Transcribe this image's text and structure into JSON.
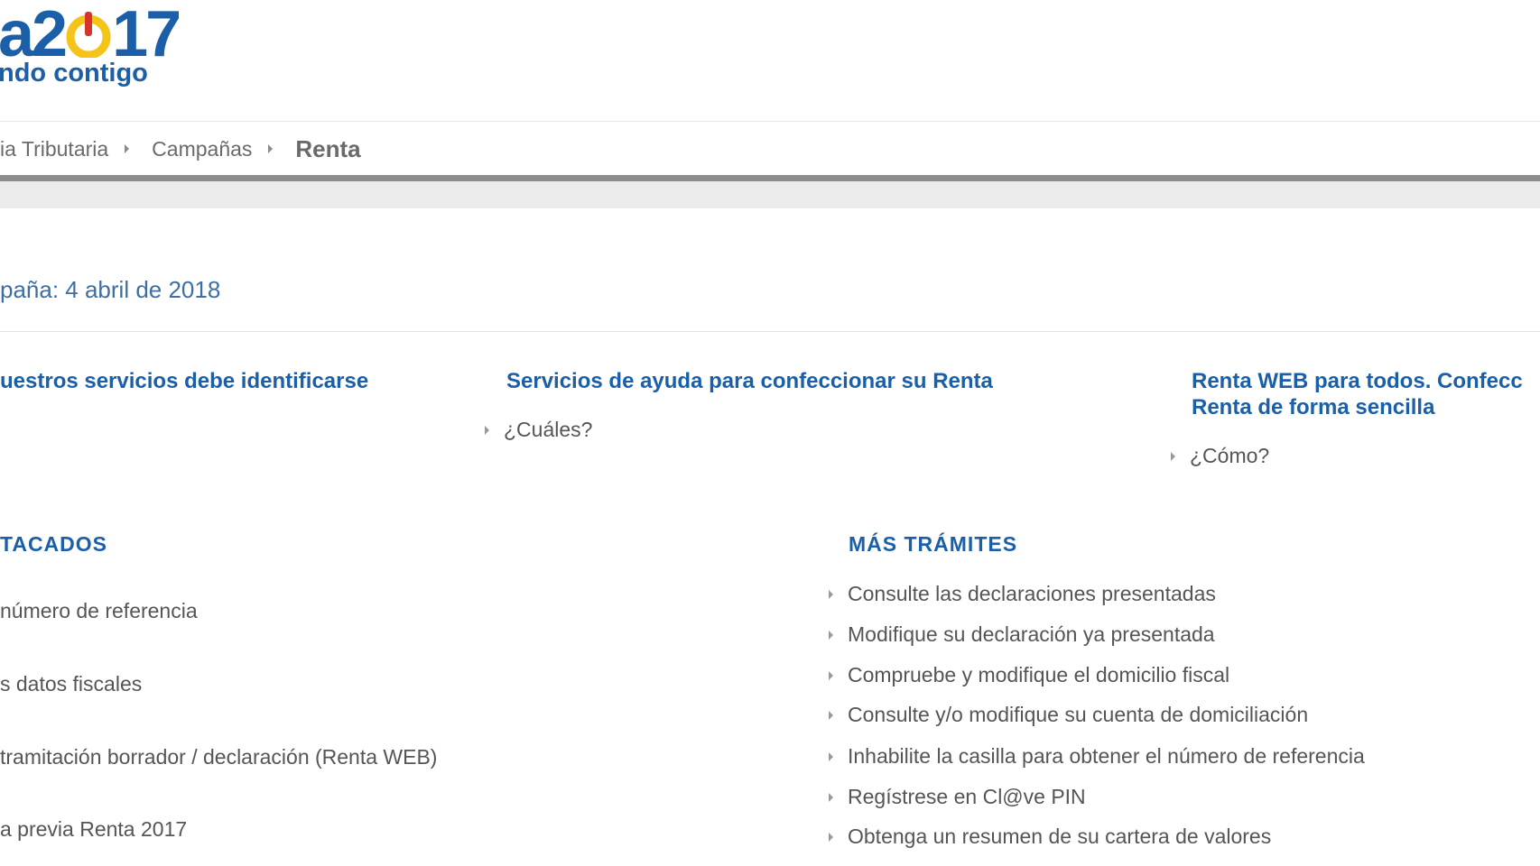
{
  "header": {
    "logo_main_left": "a2",
    "logo_main_right": "17",
    "logo_sub": "ndo contigo"
  },
  "breadcrumb": {
    "items": [
      "ia Tributaria",
      "Campañas"
    ],
    "current": "Renta"
  },
  "campaign": {
    "text": "paña: 4 abril de 2018"
  },
  "services": [
    {
      "title": "uestros servicios debe identificarse"
    },
    {
      "title": "Servicios de ayuda para confeccionar su Renta",
      "link": "¿Cuáles?"
    },
    {
      "title_line1": "Renta WEB para todos. Confecc",
      "title_line2": "Renta de forma sencilla",
      "link": "¿Cómo?"
    }
  ],
  "destacados": {
    "title": "TACADOS",
    "items": [
      "número de referencia",
      "s datos fiscales",
      "tramitación borrador / declaración (Renta WEB)",
      "a previa Renta 2017"
    ]
  },
  "mas_tramites": {
    "title": "MÁS TRÁMITES",
    "items": [
      "Consulte las declaraciones presentadas",
      "Modifique su declaración ya presentada",
      "Compruebe y modifique el domicilio fiscal",
      "Consulte y/o modifique su cuenta de domiciliación",
      "Inhabilite la casilla para obtener el número de referencia",
      "Regístrese en Cl@ve PIN",
      "Obtenga un resumen de su cartera de valores"
    ]
  },
  "colors": {
    "brand_blue": "#1a5fa8",
    "logo_yellow": "#f5c419",
    "logo_red": "#d9342b",
    "text_grey": "#555555"
  }
}
